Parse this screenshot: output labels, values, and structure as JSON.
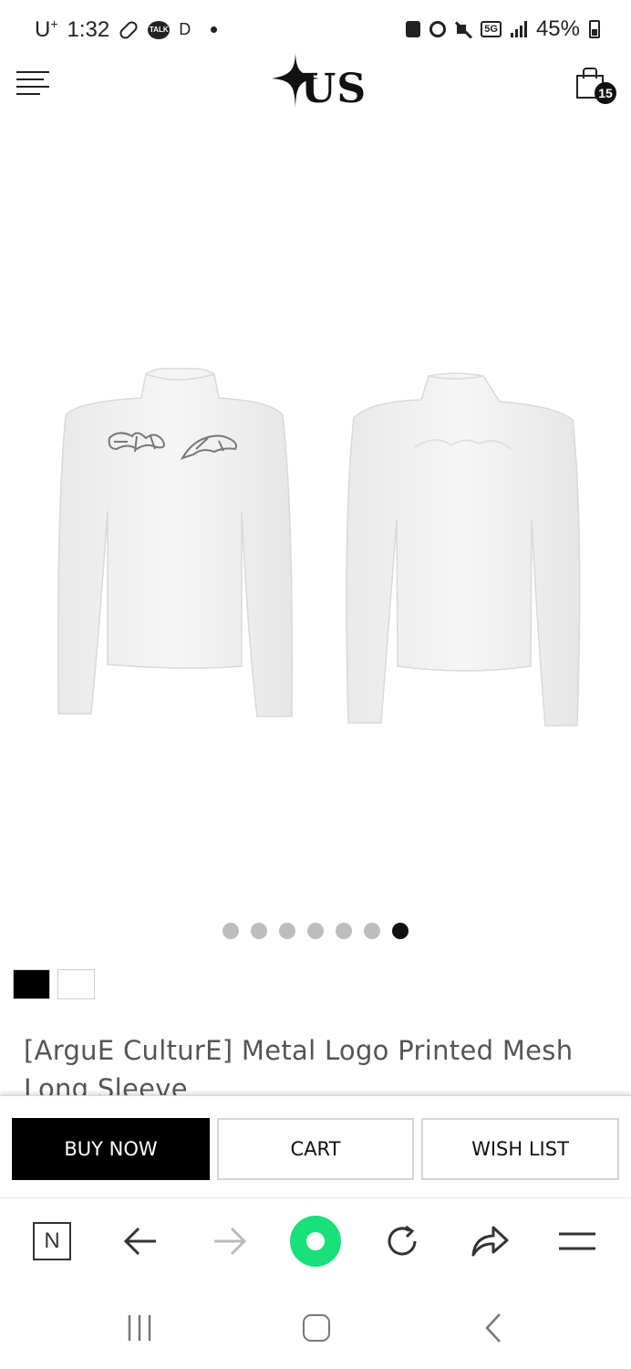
{
  "status_bar": {
    "carrier": "U",
    "carrier_sup": "+",
    "time": "1:32",
    "talk_badge": "TALK",
    "indicator_letter": "D",
    "network": "5G",
    "battery": "45%"
  },
  "header": {
    "logo_text": "US",
    "cart_count": "15"
  },
  "gallery": {
    "image_count": 7,
    "active_index": 6,
    "image_description": "White mesh long sleeve top, front and back view"
  },
  "swatches": [
    {
      "name": "Black",
      "color": "#000000"
    },
    {
      "name": "White",
      "color": "#ffffff"
    }
  ],
  "product": {
    "title": "[ArguE CulturE] Metal Logo Printed Mesh Long Sleeve"
  },
  "actions": {
    "buy_now": "BUY NOW",
    "cart": "CART",
    "wish_list": "WISH LIST"
  },
  "browser": {
    "home_letter": "N",
    "accent_color": "#19e07a"
  }
}
